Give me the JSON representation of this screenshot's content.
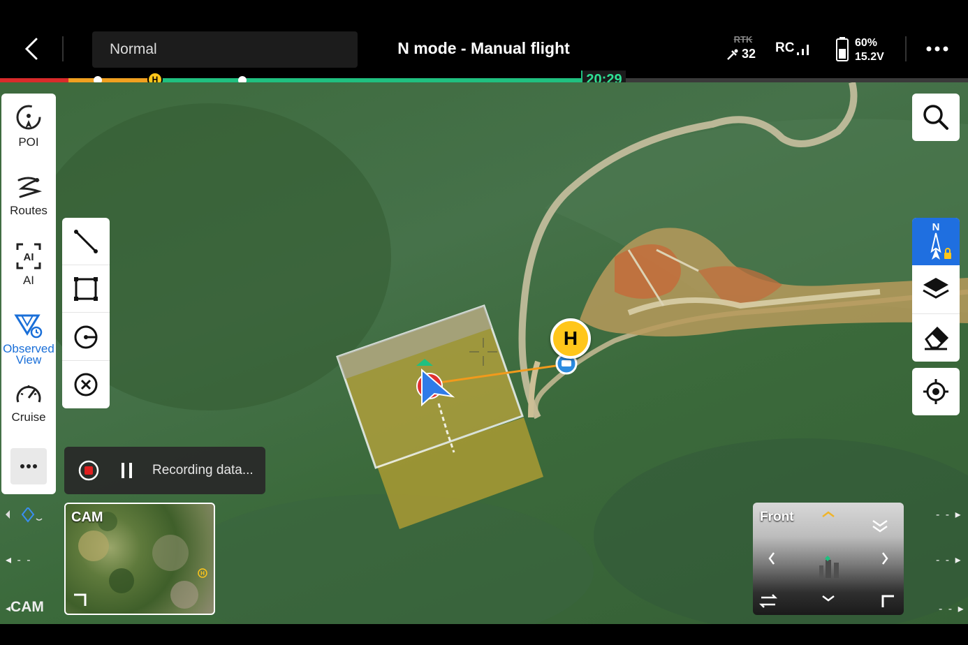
{
  "header": {
    "mode": "Normal",
    "title": "N mode - Manual flight",
    "rtk_label": "RTK",
    "satellites": "32",
    "rc_label": "RC",
    "battery_percent": "60%",
    "battery_voltage": "15.2V"
  },
  "progress": {
    "home_marker": "H",
    "flight_time": "20:29"
  },
  "left_tools": [
    {
      "label": "POI",
      "icon": "poi-icon"
    },
    {
      "label": "Routes",
      "icon": "routes-icon"
    },
    {
      "label": "AI",
      "icon": "ai-icon"
    },
    {
      "label": "Observed View",
      "icon": "observed-view-icon",
      "active": true
    },
    {
      "label": "Cruise",
      "icon": "cruise-icon"
    }
  ],
  "ai_glyph": "AI",
  "draw_tools": [
    "line-icon",
    "rectangle-icon",
    "polygon-icon",
    "close-icon"
  ],
  "recording": {
    "text": "Recording data..."
  },
  "map": {
    "home_point": "H",
    "compass_north": "N"
  },
  "camera_thumbnail": {
    "label": "CAM",
    "home_marker": "H"
  },
  "front_view": {
    "label": "Front"
  },
  "side_indicators": {
    "left_cam": "CAM",
    "dashes": "- -"
  },
  "colors": {
    "accent_blue": "#1f6fe0",
    "progress_green": "#20c080",
    "home_yellow": "#ffc61a",
    "route_orange": "#f0a020",
    "recording_red": "#e02020"
  }
}
